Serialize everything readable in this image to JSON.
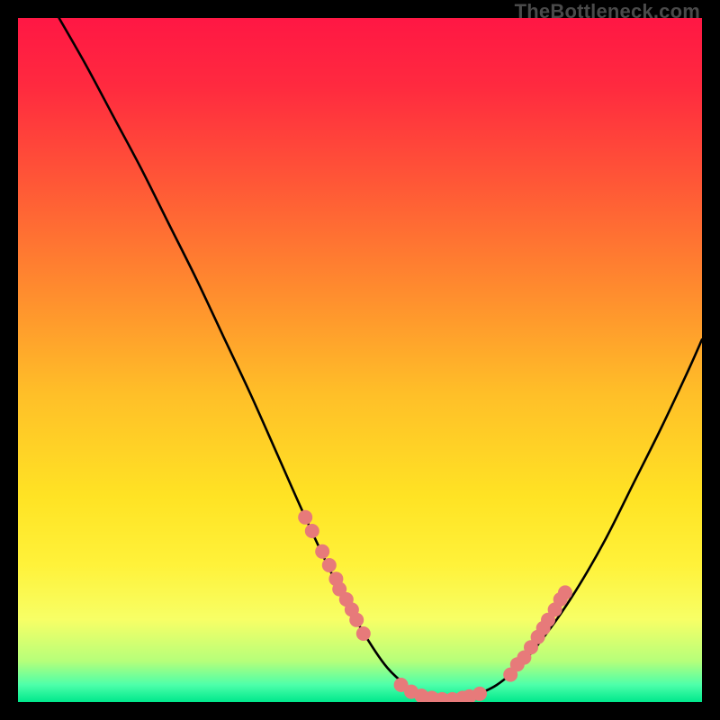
{
  "watermark": "TheBottleneck.com",
  "gradient": {
    "stops": [
      {
        "offset": 0.0,
        "color": "#ff1744"
      },
      {
        "offset": 0.1,
        "color": "#ff2a3f"
      },
      {
        "offset": 0.25,
        "color": "#ff5a36"
      },
      {
        "offset": 0.4,
        "color": "#ff8c2e"
      },
      {
        "offset": 0.55,
        "color": "#ffbf28"
      },
      {
        "offset": 0.7,
        "color": "#ffe324"
      },
      {
        "offset": 0.8,
        "color": "#fff23a"
      },
      {
        "offset": 0.88,
        "color": "#f7ff66"
      },
      {
        "offset": 0.94,
        "color": "#b6ff7a"
      },
      {
        "offset": 0.975,
        "color": "#4dffaa"
      },
      {
        "offset": 1.0,
        "color": "#00e88c"
      }
    ]
  },
  "chart_data": {
    "type": "line",
    "title": "",
    "xlabel": "",
    "ylabel": "",
    "xlim": [
      0,
      100
    ],
    "ylim": [
      0,
      100
    ],
    "series": [
      {
        "name": "curve",
        "x": [
          6,
          10,
          14,
          18,
          22,
          26,
          30,
          34,
          38,
          42,
          46,
          50,
          54,
          58,
          60,
          62,
          64,
          66,
          70,
          74,
          78,
          82,
          86,
          90,
          94,
          98,
          100
        ],
        "y": [
          100,
          93,
          85.5,
          78,
          70,
          62,
          53.5,
          45,
          36,
          27,
          18.5,
          11,
          5,
          1.5,
          0.7,
          0.4,
          0.4,
          0.7,
          2.5,
          6,
          11,
          17,
          24,
          32,
          40,
          48.5,
          53
        ],
        "stroke": "#000000",
        "stroke_width": 2.6
      }
    ],
    "marker_clusters": [
      {
        "name": "left-cluster",
        "color": "#e77a7a",
        "points": [
          {
            "x": 42.0,
            "y": 27.0
          },
          {
            "x": 43.0,
            "y": 25.0
          },
          {
            "x": 44.5,
            "y": 22.0
          },
          {
            "x": 45.5,
            "y": 20.0
          },
          {
            "x": 46.5,
            "y": 18.0
          },
          {
            "x": 47.0,
            "y": 16.5
          },
          {
            "x": 48.0,
            "y": 15.0
          },
          {
            "x": 48.8,
            "y": 13.5
          },
          {
            "x": 49.5,
            "y": 12.0
          },
          {
            "x": 50.5,
            "y": 10.0
          }
        ],
        "radius": 8
      },
      {
        "name": "bottom-cluster",
        "color": "#e77a7a",
        "points": [
          {
            "x": 56.0,
            "y": 2.5
          },
          {
            "x": 57.5,
            "y": 1.5
          },
          {
            "x": 59.0,
            "y": 0.9
          },
          {
            "x": 60.5,
            "y": 0.6
          },
          {
            "x": 62.0,
            "y": 0.4
          },
          {
            "x": 63.5,
            "y": 0.4
          },
          {
            "x": 65.0,
            "y": 0.6
          },
          {
            "x": 66.0,
            "y": 0.8
          },
          {
            "x": 67.5,
            "y": 1.2
          }
        ],
        "radius": 8
      },
      {
        "name": "right-cluster",
        "color": "#e77a7a",
        "points": [
          {
            "x": 72.0,
            "y": 4.0
          },
          {
            "x": 73.0,
            "y": 5.5
          },
          {
            "x": 74.0,
            "y": 6.5
          },
          {
            "x": 75.0,
            "y": 8.0
          },
          {
            "x": 76.0,
            "y": 9.5
          },
          {
            "x": 76.8,
            "y": 10.8
          },
          {
            "x": 77.5,
            "y": 12.0
          },
          {
            "x": 78.5,
            "y": 13.5
          },
          {
            "x": 79.3,
            "y": 15.0
          },
          {
            "x": 80.0,
            "y": 16.0
          }
        ],
        "radius": 8
      }
    ]
  }
}
